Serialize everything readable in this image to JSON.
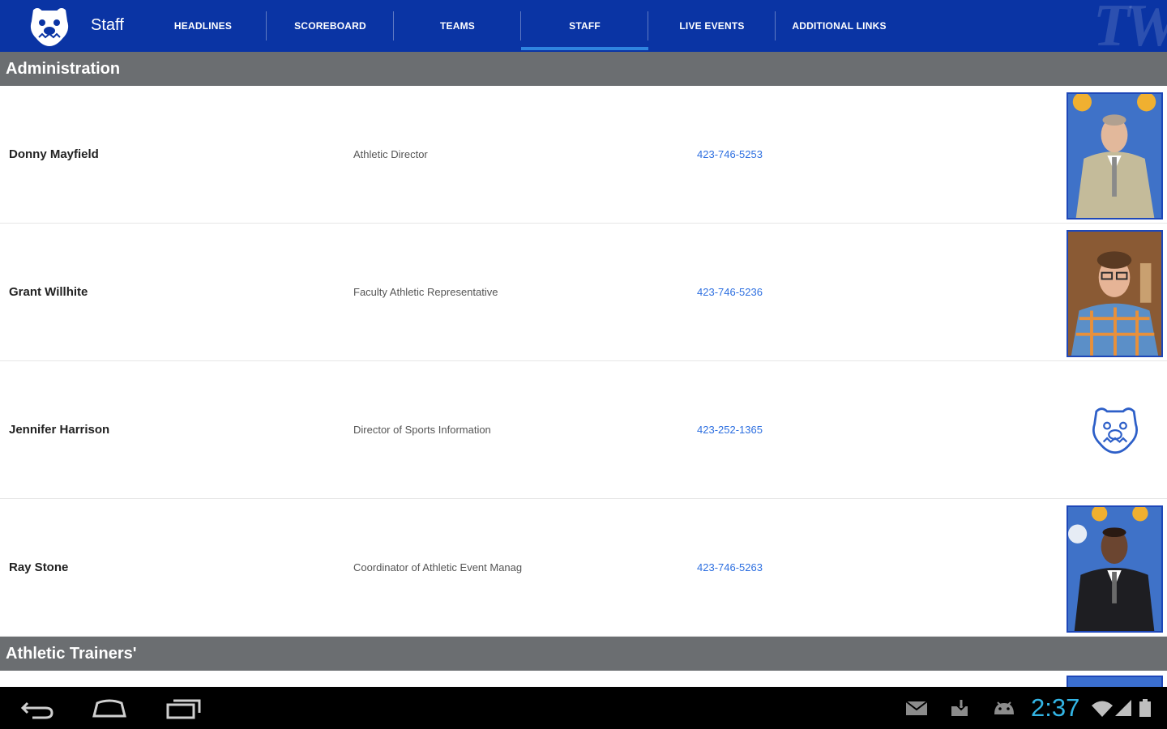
{
  "app": {
    "title": "Staff",
    "logo_icon": "bulldog-logo-icon",
    "watermark": "TW",
    "brand_color": "#0a34a4",
    "accent_color": "#2f84e0"
  },
  "tabs": [
    {
      "label": "HEADLINES",
      "selected": false
    },
    {
      "label": "SCOREBOARD",
      "selected": false
    },
    {
      "label": "TEAMS",
      "selected": false
    },
    {
      "label": "STAFF",
      "selected": true
    },
    {
      "label": "LIVE EVENTS",
      "selected": false
    },
    {
      "label": "ADDITIONAL LINKS",
      "selected": false
    }
  ],
  "sections": [
    {
      "title": "Administration",
      "staff": [
        {
          "name": "Donny Mayfield",
          "role": "Athletic Director",
          "phone": "423-746-5253",
          "photo": "photo"
        },
        {
          "name": "Grant Willhite",
          "role": "Faculty Athletic Representative",
          "phone": "423-746-5236",
          "photo": "photo"
        },
        {
          "name": "Jennifer Harrison",
          "role": "Director of Sports Information",
          "phone": "423-252-1365",
          "photo": "placeholder-logo"
        },
        {
          "name": "Ray Stone",
          "role": "Coordinator of Athletic Event Manag",
          "phone": "423-746-5263",
          "photo": "photo"
        }
      ]
    },
    {
      "title": "Athletic Trainers'",
      "staff": []
    }
  ],
  "system_bar": {
    "time": "2:37",
    "nav_icons": [
      "back-icon",
      "home-icon",
      "recent-apps-icon"
    ],
    "status_icons": [
      "gmail-icon",
      "download-icon",
      "android-icon",
      "wifi-icon",
      "signal-icon",
      "battery-icon"
    ],
    "clock_color": "#33b5e5"
  }
}
